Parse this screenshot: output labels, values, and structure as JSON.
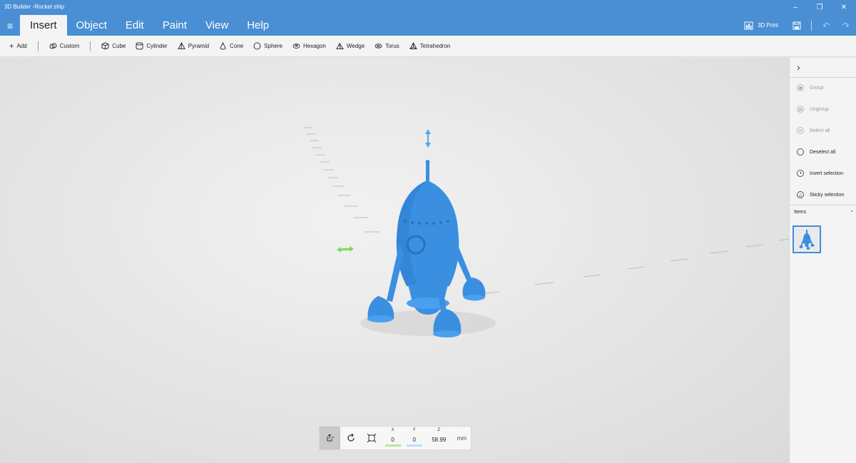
{
  "window": {
    "title": "3D Builder -Rocket ship",
    "controls": {
      "minimize": "–",
      "maximize": "❐",
      "close": "✕"
    }
  },
  "menu": {
    "tabs": [
      {
        "label": "Insert",
        "active": true
      },
      {
        "label": "Object",
        "active": false
      },
      {
        "label": "Edit",
        "active": false
      },
      {
        "label": "Paint",
        "active": false
      },
      {
        "label": "View",
        "active": false
      },
      {
        "label": "Help",
        "active": false
      }
    ],
    "print_label": "3D Print"
  },
  "toolbar": {
    "add": "Add",
    "custom": "Custom",
    "shapes": [
      "Cube",
      "Cylinder",
      "Pyramid",
      "Cone",
      "Sphere",
      "Hexagon",
      "Wedge",
      "Torus",
      "Tetrahedron"
    ]
  },
  "transform": {
    "x_label": "X",
    "x_value": "0",
    "y_label": "Y",
    "y_value": "0",
    "z_label": "Z",
    "z_value": "58.99",
    "unit": "mm"
  },
  "panel": {
    "group": "Group",
    "ungroup": "Ungroup",
    "select_all": "Select all",
    "deselect_all": "Deselect all",
    "invert_selection": "Invert selection",
    "sticky_selection": "Sticky selection",
    "items_label": "Items"
  },
  "colors": {
    "accent": "#4a8fd4",
    "model": "#3b8fe0",
    "x_axis": "#7ed957",
    "y_axis": "#4aa8f0",
    "selection": "#3f8de0"
  },
  "icons": {
    "hamburger": "hamburger-icon",
    "print": "printer-icon",
    "save": "save-icon",
    "undo": "undo-icon",
    "redo": "redo-icon"
  }
}
